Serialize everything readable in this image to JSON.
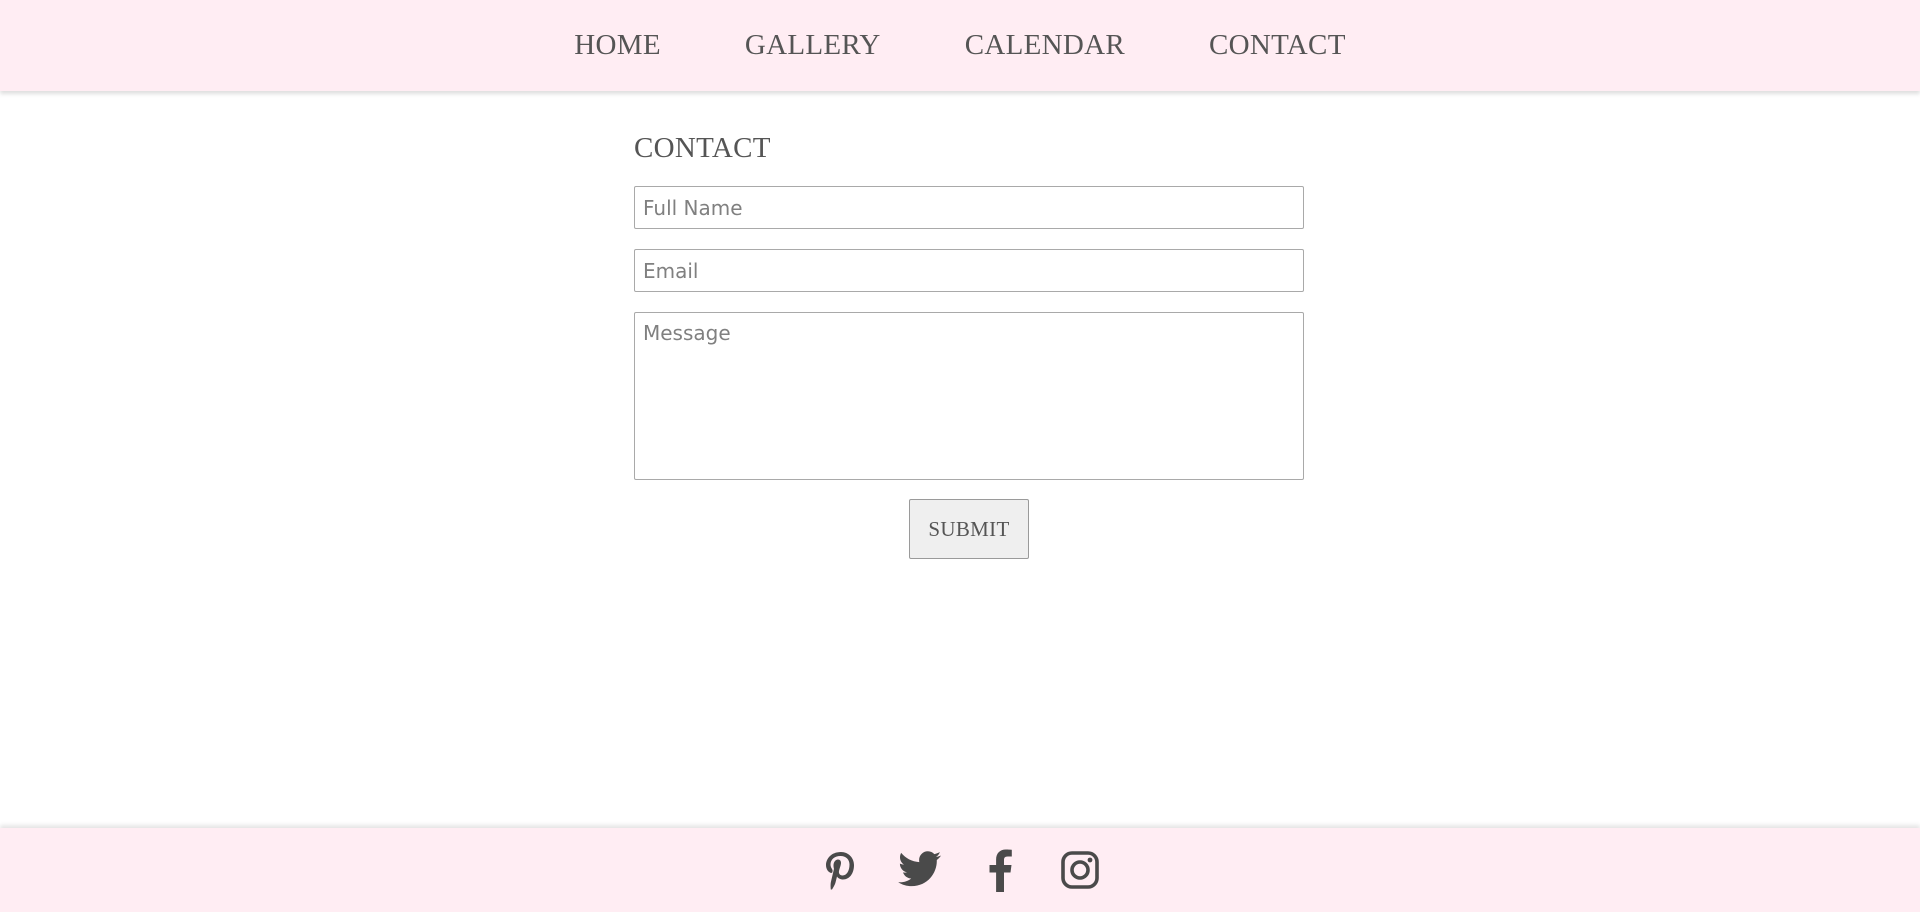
{
  "nav": {
    "items": [
      {
        "label": "HOME"
      },
      {
        "label": "GALLERY"
      },
      {
        "label": "CALENDAR"
      },
      {
        "label": "CONTACT"
      }
    ]
  },
  "contact": {
    "title": "CONTACT",
    "name_placeholder": "Full Name",
    "email_placeholder": "Email",
    "message_placeholder": "Message",
    "submit_label": "SUBMIT"
  },
  "footer": {
    "social_icons": [
      "pinterest-icon",
      "twitter-icon",
      "facebook-icon",
      "instagram-icon"
    ]
  },
  "colors": {
    "bar_background": "#ffedf3",
    "text": "#555555",
    "icon": "#4a4a4a",
    "button_background": "#efefef"
  }
}
